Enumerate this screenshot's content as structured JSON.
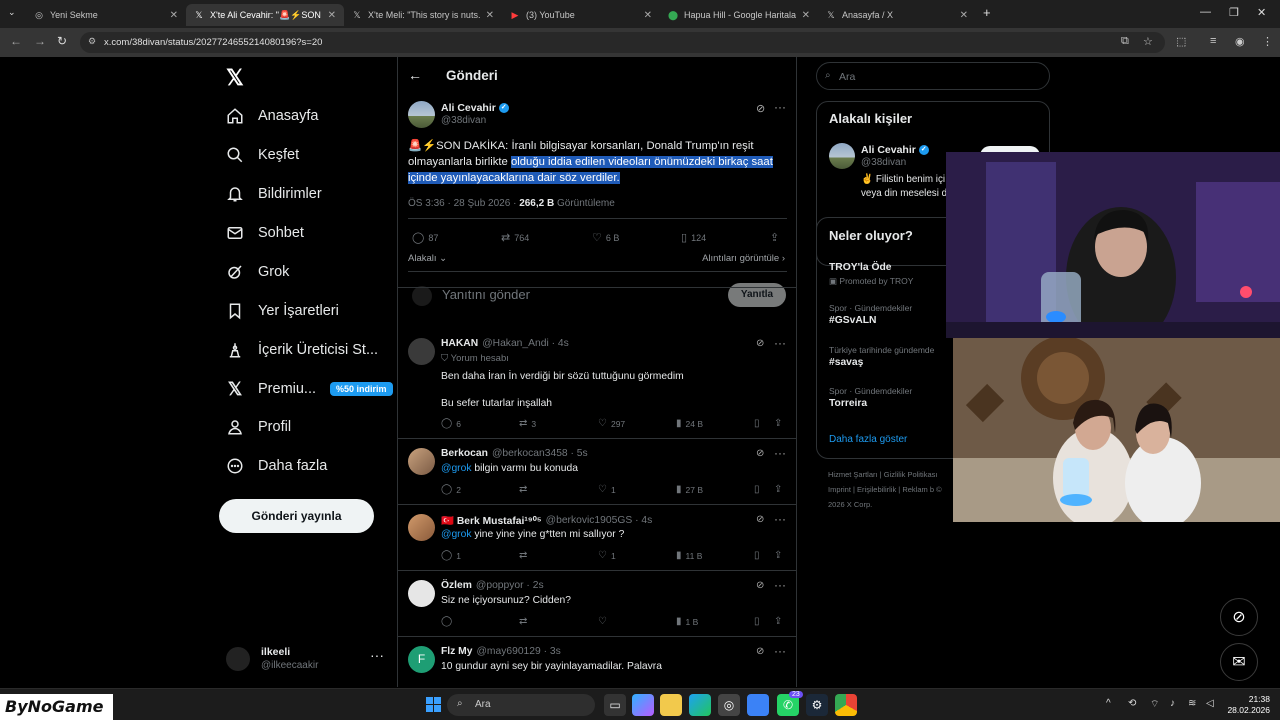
{
  "browser": {
    "tabs": [
      {
        "title": "Yeni Sekme",
        "icon": "globe-icon",
        "active": false
      },
      {
        "title": "X'te Ali Cevahir: \"🚨⚡SON DAKİKA",
        "icon": "x-logo-icon",
        "active": true
      },
      {
        "title": "X'te Meli: \"This story is nuts. Thi",
        "icon": "x-logo-icon",
        "active": false
      },
      {
        "title": "(3) YouTube",
        "icon": "youtube-icon",
        "active": false
      },
      {
        "title": "Hapua Hill - Google Haritalar",
        "icon": "maps-icon",
        "active": false
      },
      {
        "title": "Anasayfa / X",
        "icon": "x-logo-icon",
        "active": false
      }
    ],
    "url": "x.com/38divan/status/2027724655214080196?s=20"
  },
  "nav": {
    "logo": "𝕏",
    "items": [
      {
        "label": "Anasayfa",
        "icon": "home-icon"
      },
      {
        "label": "Keşfet",
        "icon": "search-icon"
      },
      {
        "label": "Bildirimler",
        "icon": "bell-icon"
      },
      {
        "label": "Sohbet",
        "icon": "mail-icon"
      },
      {
        "label": "Grok",
        "icon": "grok-icon"
      },
      {
        "label": "Yer İşaretleri",
        "icon": "bookmark-icon"
      },
      {
        "label": "İçerik Üreticisi St...",
        "icon": "creator-studio-icon"
      },
      {
        "label": "Premiu...",
        "icon": "x-premium-icon",
        "badge": "%50 indirim"
      },
      {
        "label": "Profil",
        "icon": "profile-icon"
      },
      {
        "label": "Daha fazla",
        "icon": "more-circle-icon"
      }
    ],
    "post_button": "Gönderi yayınla",
    "account": {
      "name": "ilkeeli",
      "handle": "@ilkeecaakir"
    }
  },
  "main": {
    "title": "Gönderi",
    "post": {
      "author": "Ali Cevahir",
      "handle": "@38divan",
      "text_plain": "🚨⚡SON DAKİKA: İranlı bilgisayar korsanları, Donald Trump'ın reşit olmayanlarla birlikte ",
      "text_selected": "olduğu iddia edilen videoları önümüzdeki birkaç saat içinde yayınlayacaklarına dair söz verdiler.",
      "time": "ÖS 3:36 · 28 Şub 2026 · ",
      "views": "266,2 B",
      "views_label": "Görüntüleme",
      "stats": {
        "replies": "87",
        "reposts": "764",
        "likes": "6 B",
        "bookmarks": "124"
      },
      "sort_label": "Alakalı",
      "quotes_link": "Alıntıları görüntüle",
      "reply_placeholder": "Yanıtını gönder",
      "reply_button": "Yanıtla"
    },
    "replies": [
      {
        "name": "HAKAN",
        "handle": "@Hakan_Andi · 4s",
        "note": "Yorum hesabı",
        "line1": "Ben daha İran İn verdiği bir sözü tuttuğunu görmedim",
        "line2": "Bu sefer tutarlar inşallah",
        "replies": "6",
        "reposts": "3",
        "likes": "297",
        "views": "24 B"
      },
      {
        "name": "Berkocan",
        "handle": "@berkocan3458 · 5s",
        "mention": "@grok",
        "line1": " bilgin varmı bu konuda",
        "replies": "2",
        "reposts": "",
        "likes": "1",
        "views": "27 B"
      },
      {
        "name": "Berk Mustafai¹⁹⁰⁵",
        "flag": "🇹🇷",
        "handle": "@berkovic1905GS · 4s",
        "mention": "@grok",
        "line1": " yine yine yine g*tten mi sallıyor ?",
        "replies": "1",
        "reposts": "",
        "likes": "1",
        "views": "11 B"
      },
      {
        "name": "Özlem",
        "handle": "@poppyor · 2s",
        "line1": "Siz ne içiyorsunuz? Cidden?",
        "replies": "",
        "reposts": "",
        "likes": "",
        "views": "1 B"
      },
      {
        "name": "Flz My",
        "handle": "@may690129 · 3s",
        "line1": "10 gundur ayni sey  bir yayinlayamadilar. Palavra",
        "initial": "F"
      }
    ]
  },
  "right": {
    "search_placeholder": "Ara",
    "related_title": "Alakalı kişiler",
    "related": {
      "name": "Ali Cevahir",
      "handle": "@38divan",
      "bio": "✌️ Filistin benim içi veya din meselesi d"
    },
    "trends_title": "Neler oluyor?",
    "trends": [
      {
        "name": "TROY'la Öde",
        "sub": "Promoted by TROY"
      },
      {
        "context": "Spor · Gündemdekiler",
        "name": "#GSvALN"
      },
      {
        "context": "Türkiye tarihinde gündemde",
        "name": "#savaş"
      },
      {
        "context": "Spor · Gündemdekiler",
        "name": "Torreira"
      }
    ],
    "show_more": "Daha fazla göster",
    "footer": "Hizmet Şartları | Gizlilik Politikası Imprint | Erişilebilirlik | Reklam b © 2026 X Corp."
  },
  "taskbar": {
    "watermark": "ByNoGame",
    "search": "Ara",
    "time": "21:38",
    "date": "28.02.2026",
    "whatsapp_badge": "23"
  },
  "colors": {
    "accent": "#1d9bf0",
    "background": "#000000",
    "selection": "#1f5bb8"
  }
}
